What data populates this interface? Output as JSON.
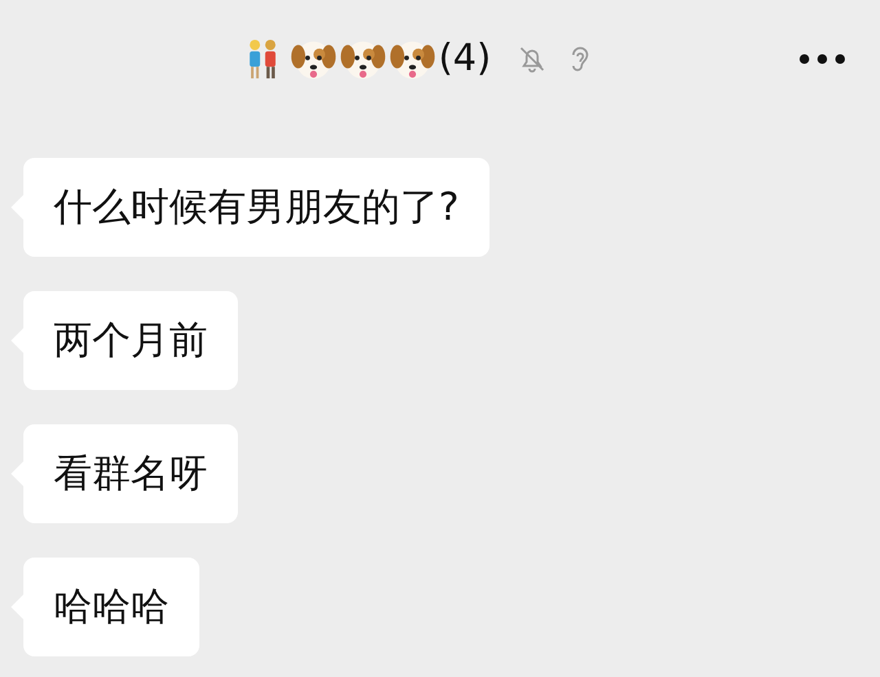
{
  "header": {
    "member_count": "(4)",
    "muted": true,
    "earpiece_mode": true
  },
  "messages": [
    {
      "text": "什么时候有男朋友的了?"
    },
    {
      "text": "两个月前"
    },
    {
      "text": "看群名呀"
    },
    {
      "text": "哈哈哈"
    }
  ]
}
